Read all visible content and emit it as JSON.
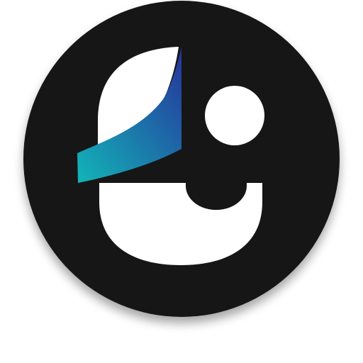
{
  "logo": {
    "icon": "app-logo-icon",
    "colors": {
      "background": "#ffffff",
      "disc": "#161616",
      "shape": "#ffffff",
      "gradient_start": "#12b5b8",
      "gradient_end": "#26339b",
      "shadow": "#000000"
    }
  }
}
